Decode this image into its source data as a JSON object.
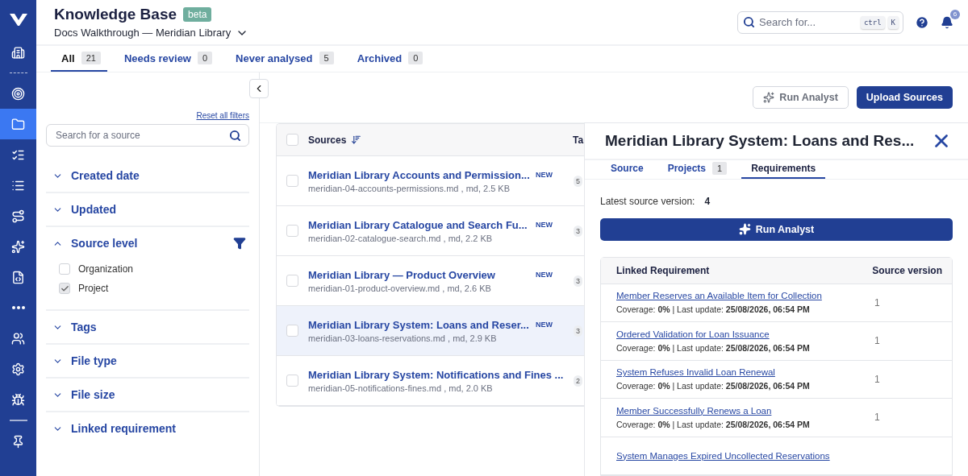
{
  "nav_items": [
    {
      "kind": "building",
      "selected": false
    },
    {
      "kind": "divider-dots"
    },
    {
      "kind": "target",
      "selected": false
    },
    {
      "kind": "folder",
      "selected": true
    },
    {
      "kind": "list-checks",
      "selected": false
    },
    {
      "kind": "list",
      "selected": false
    },
    {
      "kind": "route",
      "selected": false
    },
    {
      "kind": "sparkles",
      "selected": false
    },
    {
      "kind": "file-code",
      "selected": false
    },
    {
      "kind": "more",
      "selected": false
    },
    {
      "kind": "users",
      "selected": false
    },
    {
      "kind": "v-gear",
      "selected": false
    },
    {
      "kind": "bug",
      "selected": false
    },
    {
      "kind": "divider-line"
    },
    {
      "kind": "pin",
      "selected": false
    }
  ],
  "header": {
    "title": "Knowledge Base",
    "badge": "beta",
    "project": "Docs Walkthrough — Meridian Library",
    "search": {
      "placeholder": "Search for...",
      "keys": [
        "ctrl",
        "K"
      ]
    },
    "notifications": "6"
  },
  "tabs": [
    {
      "label": "All",
      "count": "21",
      "selected": true
    },
    {
      "label": "Needs review",
      "count": "0",
      "selected": false
    },
    {
      "label": "Never analysed",
      "count": "5",
      "selected": false
    },
    {
      "label": "Archived",
      "count": "0",
      "selected": false
    }
  ],
  "filters": {
    "reset": "Reset all filters",
    "search": {
      "placeholder": "Search for a source"
    },
    "sections": [
      {
        "label": "Created date",
        "expanded": false,
        "active_filter": false
      },
      {
        "label": "Updated",
        "expanded": false,
        "active_filter": false
      },
      {
        "label": "Source level",
        "expanded": true,
        "active_filter": true,
        "options": [
          {
            "label": "Organization",
            "checked": false
          },
          {
            "label": "Project",
            "checked": true
          }
        ]
      },
      {
        "label": "Tags",
        "expanded": false,
        "active_filter": false
      },
      {
        "label": "File type",
        "expanded": false,
        "active_filter": false
      },
      {
        "label": "File size",
        "expanded": false,
        "active_filter": false
      },
      {
        "label": "Linked requirement",
        "expanded": false,
        "active_filter": false
      }
    ]
  },
  "toolbar": {
    "run_analyst": "Run Analyst",
    "upload": "Upload Sources"
  },
  "table": {
    "select_all": false,
    "columns": [
      "Sources",
      "Ta"
    ],
    "rows": [
      {
        "title": "Meridian Library Accounts and Permission...",
        "badge": "NEW",
        "meta": "meridian-04-accounts-permissions.md , md, 2.5 KB",
        "column_2": "5",
        "selected": false
      },
      {
        "title": "Meridian Library Catalogue and Search Fu...",
        "badge": "NEW",
        "meta": "meridian-02-catalogue-search.md , md, 2.2 KB",
        "column_2": "3",
        "selected": false
      },
      {
        "title": "Meridian Library — Product Overview",
        "badge": "NEW",
        "meta": "meridian-01-product-overview.md , md, 2.6 KB",
        "column_2": "3",
        "selected": false
      },
      {
        "title": "Meridian Library System: Loans and Reser...",
        "badge": "NEW",
        "meta": "meridian-03-loans-reservations.md , md, 2.9 KB",
        "column_2": "3",
        "selected": true
      },
      {
        "title": "Meridian Library System: Notifications and Fines ...",
        "meta": "meridian-05-notifications-fines.md , md, 2.0 KB",
        "column_2": "2",
        "selected": false
      }
    ]
  },
  "drawer": {
    "title": "Meridian Library System: Loans and Res...",
    "tabs": [
      {
        "label": "Source",
        "selected": false
      },
      {
        "label": "Projects",
        "count": "1",
        "selected": false
      },
      {
        "label": "Requirements",
        "selected": true
      }
    ],
    "version_label": "Latest source version:",
    "version": "4",
    "run_analyst": "Run Analyst",
    "columns": [
      "Linked Requirement",
      "Source version"
    ],
    "rows": [
      {
        "title": "Member Reserves an Available Item for Collection",
        "meta": "Coverage: **0%** | Last update: **25/08/2026, 06:54 PM**",
        "version": "1"
      },
      {
        "title": "Ordered Validation for Loan Issuance",
        "meta": "Coverage: **0%** | Last update: **25/08/2026, 06:54 PM**",
        "version": "1"
      },
      {
        "title": "System Refuses Invalid Loan Renewal",
        "meta": "Coverage: **0%** | Last update: **25/08/2026, 06:54 PM**",
        "version": "1"
      },
      {
        "title": "Member Successfully Renews a Loan",
        "meta": "Coverage: **0%** | Last update: **25/08/2026, 06:54 PM**",
        "version": "1"
      },
      {
        "title": "System Manages Expired Uncollected Reservations"
      }
    ]
  }
}
